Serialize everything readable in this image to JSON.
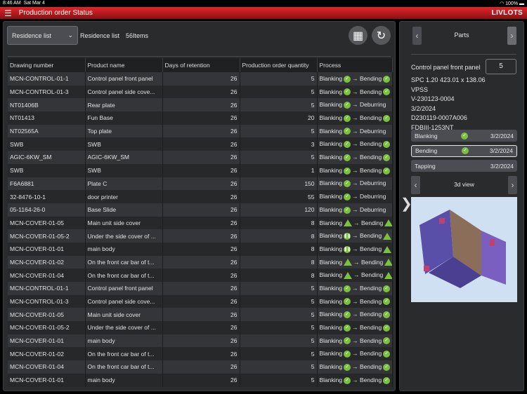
{
  "status": {
    "time": "8:46 AM",
    "date": "Sat Mar 4",
    "battery": "100%"
  },
  "header": {
    "title": "Production order Status",
    "logo": "LIVLOTS"
  },
  "toolbar": {
    "dropdown": "Residence list",
    "label": "Residence list",
    "count": "56Items"
  },
  "table": {
    "columns": [
      "Drawing number",
      "Product name",
      "Days of retention",
      "Production order quantity",
      "Process"
    ],
    "rows": [
      {
        "d": "MCN-CONTROL-01-1",
        "p": "Control panel front panel",
        "days": "26",
        "q": "5",
        "s1": "Blanking",
        "i1": "check",
        "s2": "Bending",
        "i2": "check"
      },
      {
        "d": "MCN-CONTROL-01-3",
        "p": "Control panel side cove...",
        "days": "26",
        "q": "5",
        "s1": "Blanking",
        "i1": "check",
        "s2": "Bending",
        "i2": "check"
      },
      {
        "d": "NT01406B",
        "p": "Rear plate",
        "days": "26",
        "q": "5",
        "s1": "Blanking",
        "i1": "check",
        "s2": "Deburring",
        "i2": ""
      },
      {
        "d": "NT01413",
        "p": "Fun Base",
        "days": "26",
        "q": "20",
        "s1": "Blanking",
        "i1": "check",
        "s2": "Bending",
        "i2": "check"
      },
      {
        "d": "NT02565A",
        "p": "Top plate",
        "days": "26",
        "q": "5",
        "s1": "Blanking",
        "i1": "check",
        "s2": "Deburring",
        "i2": ""
      },
      {
        "d": "SWB",
        "p": "SWB",
        "days": "26",
        "q": "3",
        "s1": "Blanking",
        "i1": "check",
        "s2": "Bending",
        "i2": "check"
      },
      {
        "d": "AGIC-6KW_SM",
        "p": "AGIC-6KW_SM",
        "days": "26",
        "q": "5",
        "s1": "Blanking",
        "i1": "check",
        "s2": "Bending",
        "i2": "check"
      },
      {
        "d": "SWB",
        "p": "SWB",
        "days": "26",
        "q": "1",
        "s1": "Blanking",
        "i1": "check",
        "s2": "Bending",
        "i2": "check"
      },
      {
        "d": "F6A6881",
        "p": "Plate C",
        "days": "26",
        "q": "150",
        "s1": "Blanking",
        "i1": "check",
        "s2": "Deburring",
        "i2": ""
      },
      {
        "d": "32-8476-10-1",
        "p": "door printer",
        "days": "26",
        "q": "55",
        "s1": "Blanking",
        "i1": "check",
        "s2": "Deburring",
        "i2": ""
      },
      {
        "d": "05-1164-26-0",
        "p": "Base Slide",
        "days": "26",
        "q": "120",
        "s1": "Blanking",
        "i1": "check",
        "s2": "Deburring",
        "i2": ""
      },
      {
        "d": "MCN-COVER-01-05",
        "p": "Main unit side cover",
        "days": "26",
        "q": "8",
        "s1": "Blanking",
        "i1": "warn",
        "s2": "Bending",
        "i2": "warn"
      },
      {
        "d": "MCN-COVER-01-05-2",
        "p": "Under the side cover of ...",
        "days": "26",
        "q": "8",
        "s1": "Blanking",
        "i1": "pause",
        "s2": "Bending",
        "i2": "warn"
      },
      {
        "d": "MCN-COVER-01-01",
        "p": "main body",
        "days": "26",
        "q": "8",
        "s1": "Blanking",
        "i1": "pause",
        "s2": "Bending",
        "i2": "warn"
      },
      {
        "d": "MCN-COVER-01-02",
        "p": "On the front car bar of t...",
        "days": "26",
        "q": "8",
        "s1": "Blanking",
        "i1": "warn",
        "s2": "Bending",
        "i2": "warn"
      },
      {
        "d": "MCN-COVER-01-04",
        "p": "On the front car bar of t...",
        "days": "26",
        "q": "8",
        "s1": "Blanking",
        "i1": "warn",
        "s2": "Bending",
        "i2": "warn"
      },
      {
        "d": "MCN-CONTROL-01-1",
        "p": "Control panel front panel",
        "days": "26",
        "q": "5",
        "s1": "Blanking",
        "i1": "check",
        "s2": "Bending",
        "i2": "check"
      },
      {
        "d": "MCN-CONTROL-01-3",
        "p": "Control panel side cove...",
        "days": "26",
        "q": "5",
        "s1": "Blanking",
        "i1": "check",
        "s2": "Bending",
        "i2": "check"
      },
      {
        "d": "MCN-COVER-01-05",
        "p": "Main unit side cover",
        "days": "26",
        "q": "5",
        "s1": "Blanking",
        "i1": "check",
        "s2": "Bending",
        "i2": "check"
      },
      {
        "d": "MCN-COVER-01-05-2",
        "p": "Under the side cover of ...",
        "days": "26",
        "q": "5",
        "s1": "Blanking",
        "i1": "check",
        "s2": "Bending",
        "i2": "check"
      },
      {
        "d": "MCN-COVER-01-01",
        "p": "main body",
        "days": "26",
        "q": "5",
        "s1": "Blanking",
        "i1": "check",
        "s2": "Bending",
        "i2": "check"
      },
      {
        "d": "MCN-COVER-01-02",
        "p": "On the front car bar of t...",
        "days": "26",
        "q": "5",
        "s1": "Blanking",
        "i1": "check",
        "s2": "Bending",
        "i2": "check"
      },
      {
        "d": "MCN-COVER-01-04",
        "p": "On the front car bar of t...",
        "days": "26",
        "q": "5",
        "s1": "Blanking",
        "i1": "check",
        "s2": "Bending",
        "i2": "check"
      },
      {
        "d": "MCN-COVER-01-01",
        "p": "main body",
        "days": "26",
        "q": "5",
        "s1": "Blanking",
        "i1": "check",
        "s2": "Bending",
        "i2": "check"
      }
    ]
  },
  "side": {
    "title": "Parts",
    "part_name": "Control panel front panel",
    "quantity": "5",
    "info": [
      "SPC 1.20 423.01 x 138.06",
      "VPSS",
      "V-230123-0004",
      "3/2/2024",
      "D230119-0007A006",
      "FDBIII-1253NT"
    ],
    "processes": [
      {
        "name": "Blanking",
        "done": true,
        "date": "3/2/2024",
        "selected": false
      },
      {
        "name": "Bending",
        "done": true,
        "date": "3/2/2024",
        "selected": true
      },
      {
        "name": "Tapping",
        "done": false,
        "date": "3/2/2024",
        "selected": false
      }
    ],
    "view_label": "3d view"
  },
  "colors": {
    "accent": "#e0262b",
    "ok": "#7ac13f"
  }
}
